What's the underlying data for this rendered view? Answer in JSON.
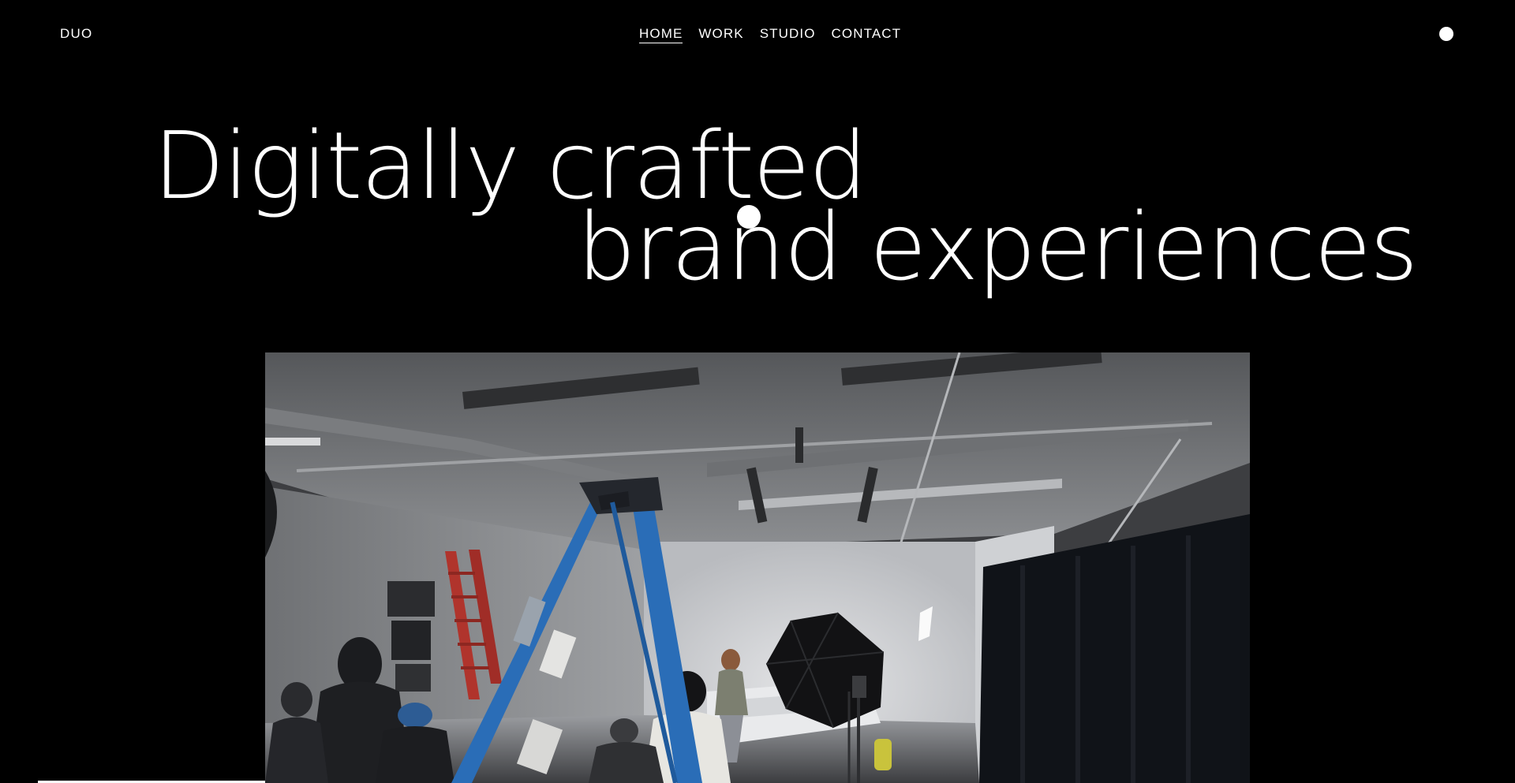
{
  "header": {
    "logo": "DUO",
    "nav": [
      {
        "label": "HOME",
        "active": true
      },
      {
        "label": "WORK",
        "active": false
      },
      {
        "label": "STUDIO",
        "active": false
      },
      {
        "label": "CONTACT",
        "active": false
      }
    ],
    "menu_icon": "circle-menu-icon"
  },
  "hero": {
    "line1": "Digitally crafted",
    "line2": "brand experiences"
  },
  "media": {
    "kind": "photo-studio-video",
    "scroll_progress": 0.15
  },
  "colors": {
    "background": "#000000",
    "text": "#ffffff"
  }
}
